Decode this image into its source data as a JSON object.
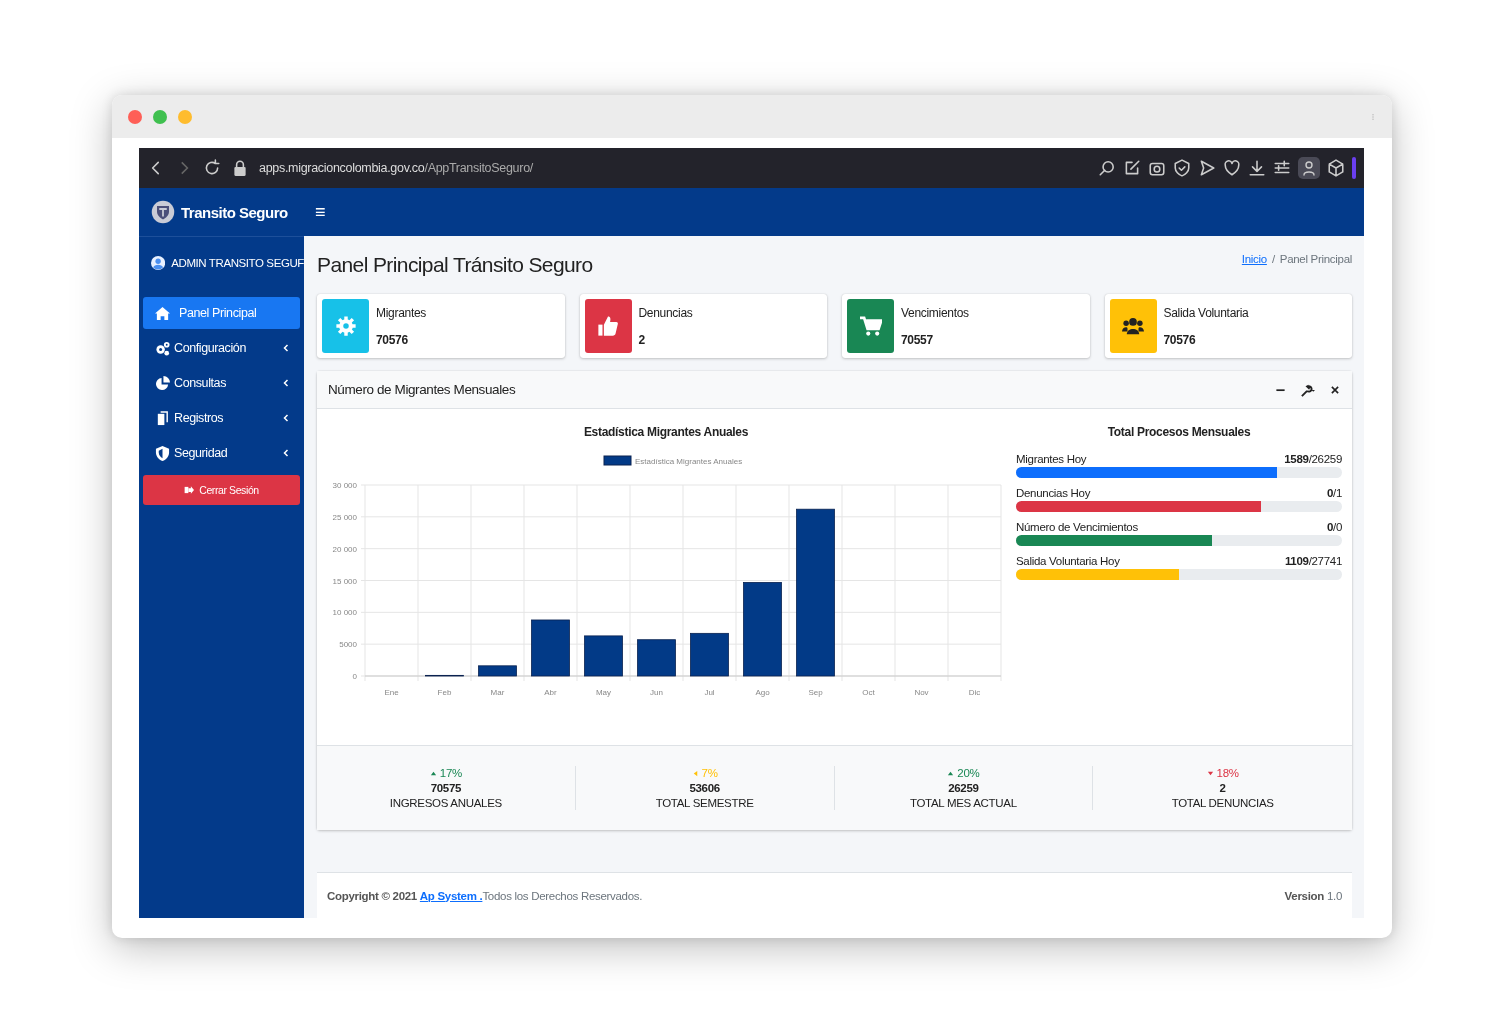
{
  "browser": {
    "url_host": "apps.migracioncolombia.gov.co",
    "url_path": "/AppTransitoSeguro/"
  },
  "sidebar": {
    "brand": "Transito Seguro",
    "user": "ADMIN TRANSITO SEGUF",
    "items": [
      {
        "label": "Panel Principal",
        "kind": "home",
        "selected": true,
        "submenu": false
      },
      {
        "label": "Configuración",
        "kind": "gears",
        "selected": false,
        "submenu": true
      },
      {
        "label": "Consultas",
        "kind": "pie",
        "selected": false,
        "submenu": true
      },
      {
        "label": "Registros",
        "kind": "copy",
        "selected": false,
        "submenu": true
      },
      {
        "label": "Seguridad",
        "kind": "shield",
        "selected": false,
        "submenu": true
      }
    ],
    "logout": "Cerrar Sesión"
  },
  "header": {
    "menu_toggle": "≡",
    "title": "Panel Principal Tránsito Seguro",
    "breadcrumb": [
      {
        "label": "Inicio",
        "link": true
      },
      {
        "label": "Panel Principal",
        "link": false
      }
    ],
    "separator": "/"
  },
  "info_boxes": [
    {
      "label": "Migrantes",
      "value": "70576",
      "kind": "gear",
      "color": "#17c1e8"
    },
    {
      "label": "Denuncias",
      "value": "2",
      "kind": "thumb",
      "color": "#dc3545"
    },
    {
      "label": "Vencimientos",
      "value": "70557",
      "kind": "cart",
      "color": "#198754"
    },
    {
      "label": "Salida Voluntaria",
      "value": "70576",
      "kind": "users",
      "color": "#ffc107"
    }
  ],
  "card": {
    "title": "Número de Migrantes Mensuales",
    "chart_data": {
      "type": "bar",
      "title": "Estadística Migrantes Anuales",
      "categories": [
        "Ene",
        "Feb",
        "Mar",
        "Abr",
        "May",
        "Jun",
        "Jul",
        "Ago",
        "Sep",
        "Oct",
        "Nov",
        "Dic"
      ],
      "series": [
        {
          "name": "Estadística Migrantes Anuales",
          "color": "#023a87",
          "values": [
            0,
            100,
            1600,
            8800,
            6300,
            5700,
            6700,
            14700,
            26200,
            0,
            0,
            0
          ]
        }
      ],
      "ylim": [
        0,
        30000
      ],
      "yticks": [
        0,
        5000,
        {
          "value": 10000,
          "label": "10 000"
        },
        {
          "value": 15000,
          "label": "15 000"
        },
        {
          "value": 20000,
          "label": "20 000"
        },
        {
          "value": 25000,
          "label": "25 000"
        },
        {
          "value": 30000,
          "label": "30 000"
        }
      ],
      "grid": true
    },
    "progress": {
      "title": "Total Procesos Mensuales",
      "items": [
        {
          "label": "Migrantes Hoy",
          "reading": "**1589**/26259",
          "level": 0.8,
          "color": "#0d6efd"
        },
        {
          "label": "Denuncias Hoy",
          "reading": "**0**/1",
          "level": 0.75,
          "color": "#dc3545"
        },
        {
          "label": "Número de Vencimientos",
          "reading": "**0**/0",
          "level": 0.6,
          "color": "#198754"
        },
        {
          "label": "Salida Voluntaria Hoy",
          "reading": "**1109**/27741",
          "level": 0.5,
          "color": "#ffc107"
        }
      ]
    },
    "stats": [
      {
        "kind": "up",
        "percent": "17%",
        "value": "70575",
        "label": "INGRESOS ANUALES"
      },
      {
        "kind": "left",
        "percent": "7%",
        "value": "53606",
        "label": "TOTAL SEMESTRE"
      },
      {
        "kind": "up",
        "percent": "20%",
        "value": "26259",
        "label": "TOTAL MES ACTUAL"
      },
      {
        "kind": "down",
        "percent": "18%",
        "value": "2",
        "label": "TOTAL DENUNCIAS"
      }
    ]
  },
  "footer": {
    "copyright": "**Copyright © 2021** ",
    "link": "Ap System .",
    "rest": "Todos los Derechos Reservados.",
    "version": "**Version** 1.0"
  }
}
